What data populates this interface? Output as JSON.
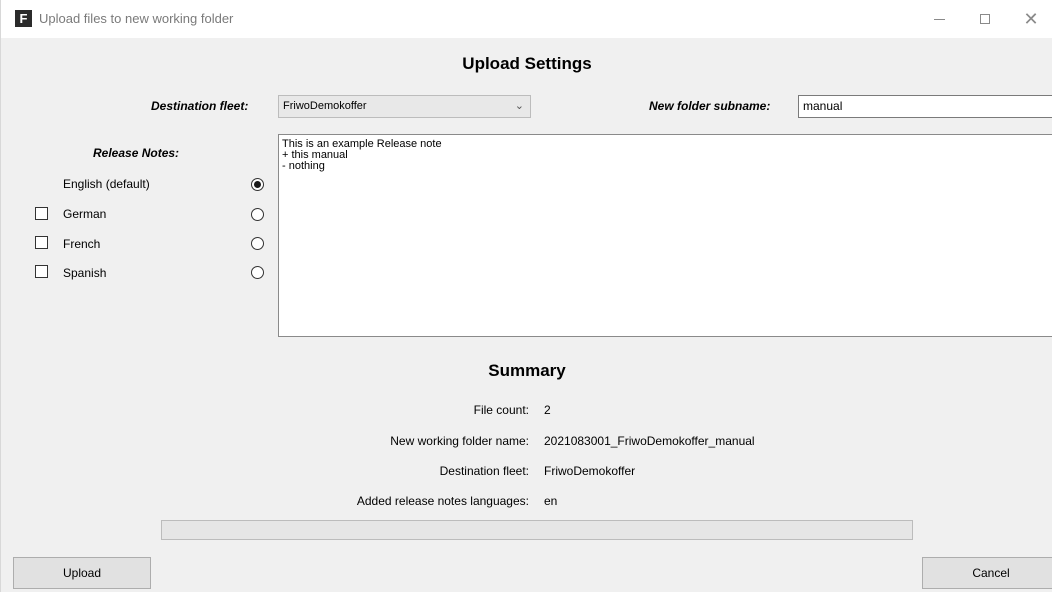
{
  "window": {
    "app_icon_letter": "F",
    "title": "Upload files to new working folder",
    "controls": [
      "minimize-icon",
      "maximize-icon",
      "close-icon"
    ]
  },
  "upload_settings": {
    "heading": "Upload Settings",
    "destination_fleet_label": "Destination fleet:",
    "destination_fleet_value": "FriwoDemokoffer",
    "new_folder_label": "New folder subname:",
    "new_folder_value": "manual"
  },
  "release_notes": {
    "label": "Release Notes:",
    "text_lines": [
      "This is an example Release note",
      "+ this manual",
      "- nothing"
    ],
    "languages": [
      {
        "label": "English (default)",
        "has_checkbox": false,
        "checked": false,
        "selected": true
      },
      {
        "label": "German",
        "has_checkbox": true,
        "checked": false,
        "selected": false
      },
      {
        "label": "French",
        "has_checkbox": true,
        "checked": false,
        "selected": false
      },
      {
        "label": "Spanish",
        "has_checkbox": true,
        "checked": false,
        "selected": false
      }
    ]
  },
  "summary": {
    "heading": "Summary",
    "rows": [
      {
        "label": "File count:",
        "value": "2"
      },
      {
        "label": "New working folder name:",
        "value": "2021083001_FriwoDemokoffer_manual"
      },
      {
        "label": "Destination fleet:",
        "value": "FriwoDemokoffer"
      },
      {
        "label": "Added release notes languages:",
        "value": "en"
      }
    ]
  },
  "progress": {
    "fraction": 0
  },
  "buttons": {
    "upload_label": "Upload",
    "cancel_label": "Cancel"
  }
}
